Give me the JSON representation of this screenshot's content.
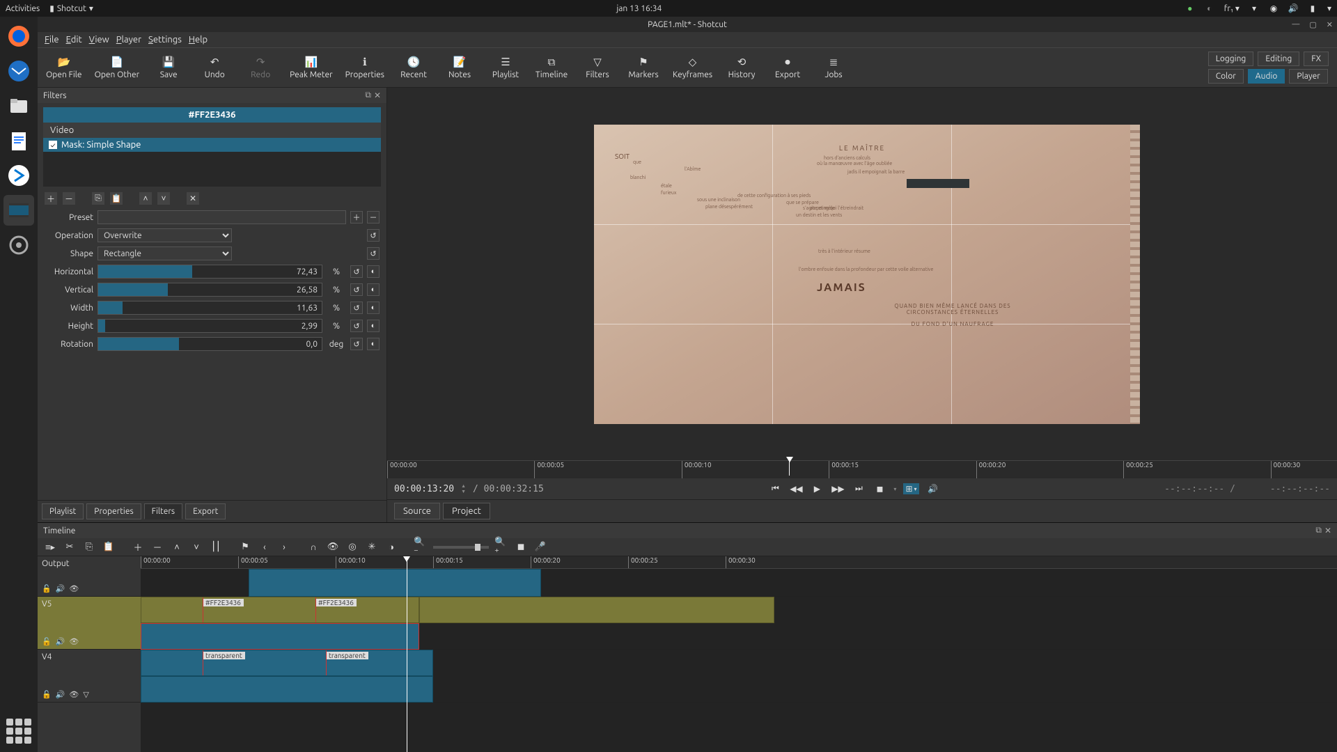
{
  "gnome": {
    "activities": "Activities",
    "app": "Shotcut",
    "clock": "jan 13  16:34",
    "keyboard": "fr₁"
  },
  "window": {
    "title": "PAGE1.mlt* - Shotcut"
  },
  "menu": {
    "file": "File",
    "edit": "Edit",
    "view": "View",
    "player": "Player",
    "settings": "Settings",
    "help": "Help"
  },
  "toolbar": {
    "open_file": "Open File",
    "open_other": "Open Other",
    "save": "Save",
    "undo": "Undo",
    "redo": "Redo",
    "peak_meter": "Peak Meter",
    "properties": "Properties",
    "recent": "Recent",
    "notes": "Notes",
    "playlist": "Playlist",
    "timeline": "Timeline",
    "filters": "Filters",
    "markers": "Markers",
    "keyframes": "Keyframes",
    "history": "History",
    "export": "Export",
    "jobs": "Jobs"
  },
  "right_tabs": {
    "logging": "Logging",
    "editing": "Editing",
    "fx": "FX",
    "color": "Color",
    "audio": "Audio",
    "player": "Player"
  },
  "filters_panel": {
    "title": "Filters",
    "clip_name": "#FF2E3436",
    "section": "Video",
    "filter_name": "Mask: Simple Shape",
    "preset_label": "Preset",
    "operation_label": "Operation",
    "operation_value": "Overwrite",
    "shape_label": "Shape",
    "shape_value": "Rectangle",
    "horizontal_label": "Horizontal",
    "horizontal_value": "72,43",
    "vertical_label": "Vertical",
    "vertical_value": "26,58",
    "width_label": "Width",
    "width_value": "11,63",
    "height_label": "Height",
    "height_value": "2,99",
    "rotation_label": "Rotation",
    "rotation_value": "0,0",
    "pct": "%",
    "deg": "deg"
  },
  "panel_tabs": {
    "playlist": "Playlist",
    "properties": "Properties",
    "filters": "Filters",
    "export": "Export"
  },
  "player": {
    "current_tc": "00:00:13:20",
    "total_tc": "/ 00:00:32:15",
    "ruler": [
      "00:00:00",
      "00:00:05",
      "00:00:10",
      "00:00:15",
      "00:00:20",
      "00:00:25",
      "00:00:30"
    ],
    "in_out_left": "--:--:--:-- /",
    "in_out_right": "--:--:--:--",
    "source": "Source",
    "project": "Project"
  },
  "preview_text": {
    "title": "LE MAÎTRE",
    "soit": "SOIT",
    "jamais": "JAMAIS",
    "caps1": "QUAND BIEN MÊME LANCÉ DANS DES",
    "caps2": "CIRCONSTANCES ÉTERNELLES",
    "caps3": "DU FOND D'UN NAUFRAGE",
    "l1": "que",
    "l2": "l'Abîme",
    "l3": "blanchi",
    "l4": "étale",
    "l5": "furieux",
    "l6": "sous une inclinaison",
    "l7": "plane désespérément",
    "l8": "hors d'anciens calculs",
    "l9": "où la manœuvre avec l'âge oubliée",
    "l10": "jadis il empoignait la barre",
    "l11": "de cette configuration à ses pieds",
    "l12": "que se prépare",
    "l13": "s'agite et mêle",
    "l14": "au poing qui l'étreindrait",
    "l15": "un destin et les vents",
    "l16": "très à l'intérieur résume",
    "l17": "l'ombre enfouie dans la profondeur par cette voile alternative"
  },
  "timeline": {
    "title": "Timeline",
    "output": "Output",
    "ruler": [
      "00:00:00",
      "00:00:05",
      "00:00:10",
      "00:00:15",
      "00:00:20",
      "00:00:25",
      "00:00:30"
    ],
    "tracks": {
      "v5": "V5",
      "v4": "V4"
    },
    "clip_labels": {
      "ff": "#FF2E3436",
      "transparent": "transparent"
    }
  }
}
